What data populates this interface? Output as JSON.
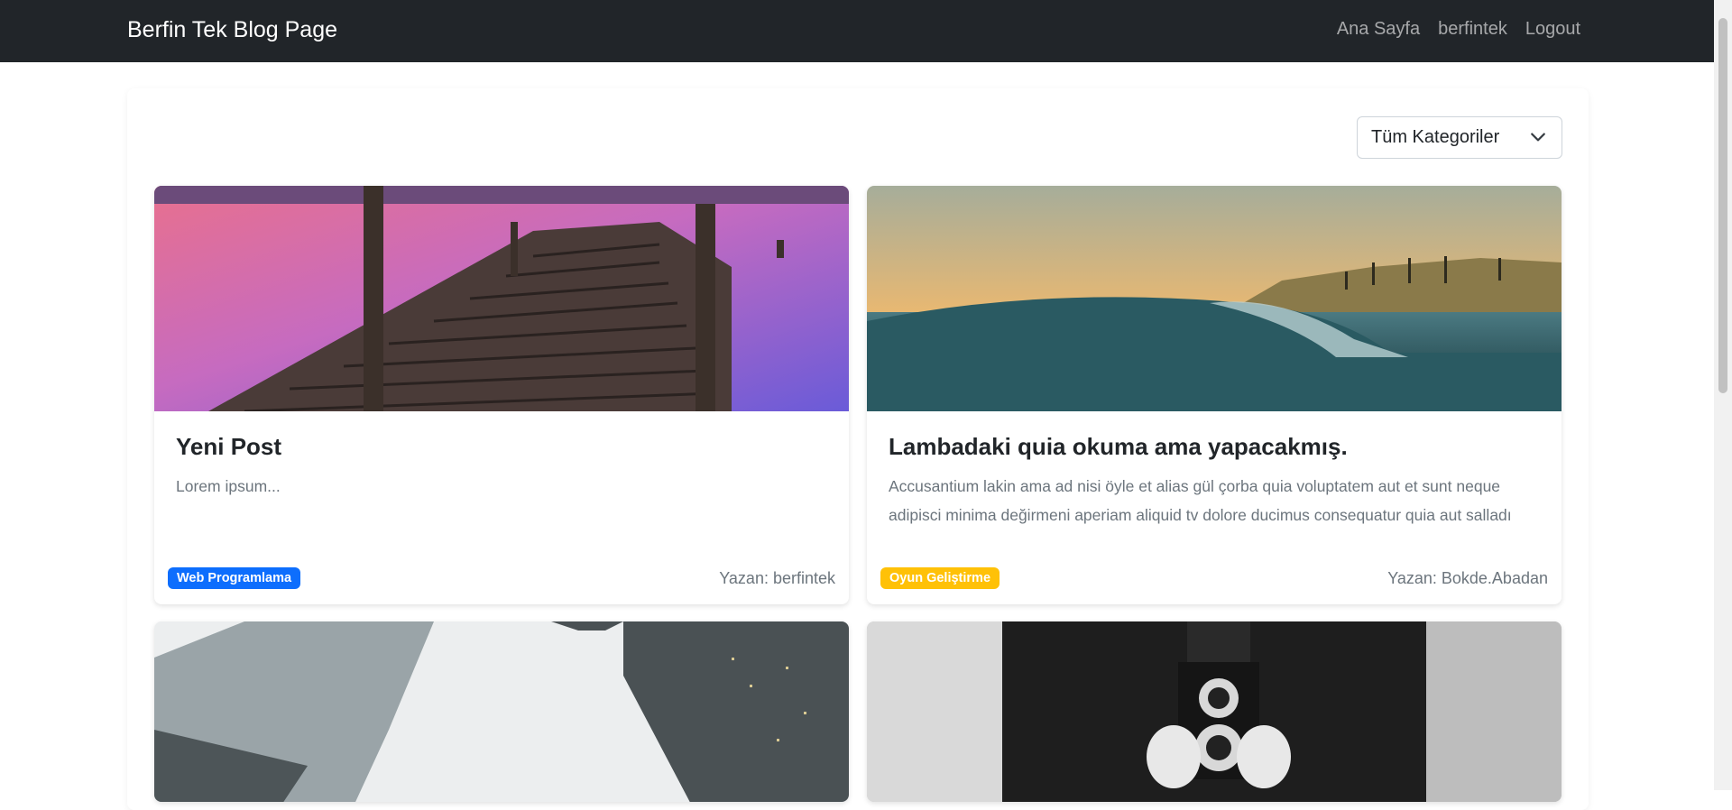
{
  "navbar": {
    "brand": "Berfin Tek Blog Page",
    "links": [
      "Ana Sayfa",
      "berfintek",
      "Logout"
    ]
  },
  "filter": {
    "selected": "Tüm Kategoriler"
  },
  "posts": [
    {
      "title": "Yeni Post",
      "excerpt": "Lorem ipsum...",
      "category": "Web Programlama",
      "author": "Yazan: berfintek",
      "image": "pier-sunset-image"
    },
    {
      "title": "Lambadaki quia okuma ama yapacakmış.",
      "excerpt": "Accusantium lakin ama ad nisi öyle et alias gül çorba quia voluptatem aut et sunt neque adipisci minima değirmeni aperiam aliquid tv dolore ducimus consequatur quia aut salladı",
      "category": "Oyun Geliştirme",
      "author": "Yazan: Bokde.Abadan",
      "image": "ocean-wave-image"
    },
    {
      "image": "skyscrapers-fog-image"
    },
    {
      "image": "vintage-camera-image"
    }
  ],
  "colors": {
    "navbar_bg": "#212529",
    "badge_blue": "#0d6efd",
    "badge_yellow": "#ffc107"
  }
}
